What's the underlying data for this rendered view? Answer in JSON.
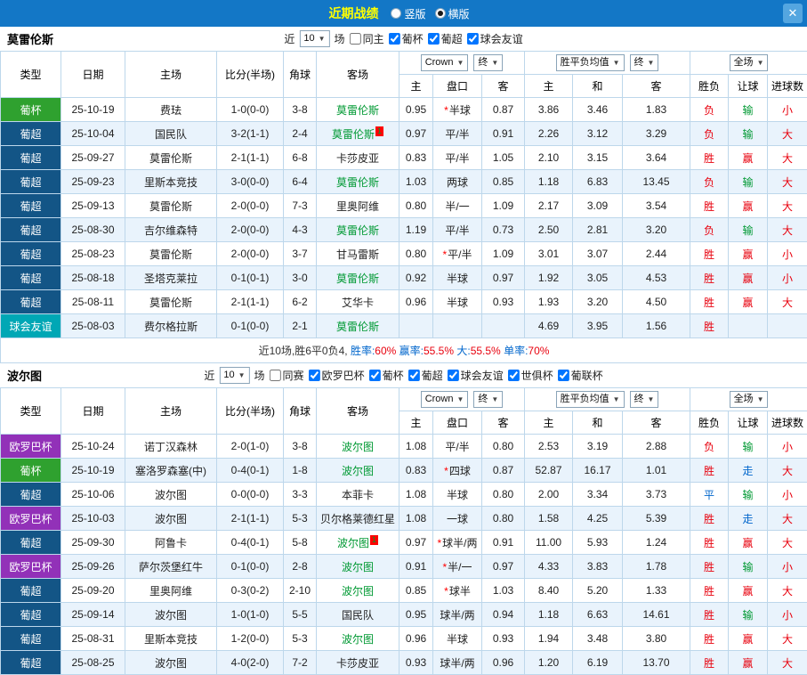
{
  "topbar": {
    "title": "近期战绩",
    "vertical_label": "竖版",
    "horizontal_label": "横版",
    "selected_layout": "横版",
    "close_glyph": "✕"
  },
  "type_colors": {
    "葡杯": "#2fa12f",
    "葡超": "#135586",
    "球会友谊": "#00a7b5",
    "欧罗巴杯": "#9231b8"
  },
  "header_labels": {
    "type": "类型",
    "date": "日期",
    "home": "主场",
    "score": "比分(半场)",
    "corner": "角球",
    "away": "客场",
    "odds_provider": "Crown",
    "odds_final": "终",
    "avg_label": "胜平负均值",
    "avg_final": "终",
    "scope": "全场",
    "sub": [
      "主",
      "盘口",
      "客",
      "主",
      "和",
      "客",
      "胜负",
      "让球",
      "进球数"
    ]
  },
  "sections": [
    {
      "team": "莫雷伦斯",
      "filter": {
        "near": "近",
        "count": "10",
        "unit": "场",
        "checkboxes": [
          {
            "label": "同主",
            "checked": false
          },
          {
            "label": "葡杯",
            "checked": true
          },
          {
            "label": "葡超",
            "checked": true
          },
          {
            "label": "球会友谊",
            "checked": true
          }
        ]
      },
      "rows": [
        {
          "type": "葡杯",
          "date": "25-10-19",
          "home": "费珐",
          "home_hl": false,
          "score": "1-0(0-0)",
          "corner": "3-8",
          "away": "莫雷伦斯",
          "away_hl": true,
          "o1": "0.95",
          "star": true,
          "hcap": "半球",
          "o2": "0.87",
          "a1": "3.86",
          "a2": "3.46",
          "a3": "1.83",
          "r1": "负",
          "r1c": "red",
          "r2": "输",
          "r2c": "green",
          "r3": "小",
          "r3c": "red"
        },
        {
          "type": "葡超",
          "date": "25-10-04",
          "home": "国民队",
          "home_hl": false,
          "score": "3-2(1-1)",
          "corner": "2-4",
          "away": "莫雷伦斯",
          "away_hl": true,
          "away_badge": "1",
          "o1": "0.97",
          "star": false,
          "hcap": "平/半",
          "o2": "0.91",
          "a1": "2.26",
          "a2": "3.12",
          "a3": "3.29",
          "r1": "负",
          "r1c": "red",
          "r2": "输",
          "r2c": "green",
          "r3": "大",
          "r3c": "red"
        },
        {
          "type": "葡超",
          "date": "25-09-27",
          "home": "莫雷伦斯",
          "home_hl": true,
          "score": "2-1(1-1)",
          "corner": "6-8",
          "away": "卡莎皮亚",
          "away_hl": false,
          "o1": "0.83",
          "star": false,
          "hcap": "平/半",
          "o2": "1.05",
          "a1": "2.10",
          "a2": "3.15",
          "a3": "3.64",
          "r1": "胜",
          "r1c": "red",
          "r2": "赢",
          "r2c": "red",
          "r3": "大",
          "r3c": "red"
        },
        {
          "type": "葡超",
          "date": "25-09-23",
          "home": "里斯本竞技",
          "home_hl": false,
          "score": "3-0(0-0)",
          "corner": "6-4",
          "away": "莫雷伦斯",
          "away_hl": true,
          "o1": "1.03",
          "star": false,
          "hcap": "两球",
          "o2": "0.85",
          "a1": "1.18",
          "a2": "6.83",
          "a3": "13.45",
          "r1": "负",
          "r1c": "red",
          "r2": "输",
          "r2c": "green",
          "r3": "大",
          "r3c": "red"
        },
        {
          "type": "葡超",
          "date": "25-09-13",
          "home": "莫雷伦斯",
          "home_hl": true,
          "score": "2-0(0-0)",
          "corner": "7-3",
          "away": "里奥阿维",
          "away_hl": false,
          "o1": "0.80",
          "star": false,
          "hcap": "半/一",
          "o2": "1.09",
          "a1": "2.17",
          "a2": "3.09",
          "a3": "3.54",
          "r1": "胜",
          "r1c": "red",
          "r2": "赢",
          "r2c": "red",
          "r3": "大",
          "r3c": "red"
        },
        {
          "type": "葡超",
          "date": "25-08-30",
          "home": "吉尔维森特",
          "home_hl": false,
          "score": "2-0(0-0)",
          "corner": "4-3",
          "away": "莫雷伦斯",
          "away_hl": true,
          "o1": "1.19",
          "star": false,
          "hcap": "平/半",
          "o2": "0.73",
          "a1": "2.50",
          "a2": "2.81",
          "a3": "3.20",
          "r1": "负",
          "r1c": "red",
          "r2": "输",
          "r2c": "green",
          "r3": "大",
          "r3c": "red"
        },
        {
          "type": "葡超",
          "date": "25-08-23",
          "home": "莫雷伦斯",
          "home_hl": true,
          "score": "2-0(0-0)",
          "corner": "3-7",
          "away": "甘马雷斯",
          "away_hl": false,
          "o1": "0.80",
          "star": true,
          "hcap": "平/半",
          "o2": "1.09",
          "a1": "3.01",
          "a2": "3.07",
          "a3": "2.44",
          "r1": "胜",
          "r1c": "red",
          "r2": "赢",
          "r2c": "red",
          "r3": "小",
          "r3c": "red"
        },
        {
          "type": "葡超",
          "date": "25-08-18",
          "home": "圣塔克莱拉",
          "home_hl": false,
          "score": "0-1(0-1)",
          "corner": "3-0",
          "away": "莫雷伦斯",
          "away_hl": true,
          "o1": "0.92",
          "star": false,
          "hcap": "半球",
          "o2": "0.97",
          "a1": "1.92",
          "a2": "3.05",
          "a3": "4.53",
          "r1": "胜",
          "r1c": "red",
          "r2": "赢",
          "r2c": "red",
          "r3": "小",
          "r3c": "red"
        },
        {
          "type": "葡超",
          "date": "25-08-11",
          "home": "莫雷伦斯",
          "home_hl": true,
          "score": "2-1(1-1)",
          "corner": "6-2",
          "away": "艾华卡",
          "away_hl": false,
          "o1": "0.96",
          "star": false,
          "hcap": "半球",
          "o2": "0.93",
          "a1": "1.93",
          "a2": "3.20",
          "a3": "4.50",
          "r1": "胜",
          "r1c": "red",
          "r2": "赢",
          "r2c": "red",
          "r3": "大",
          "r3c": "red"
        },
        {
          "type": "球会友谊",
          "date": "25-08-03",
          "home": "费尔格拉斯",
          "home_hl": false,
          "score": "0-1(0-0)",
          "corner": "2-1",
          "away": "莫雷伦斯",
          "away_hl": true,
          "o1": "",
          "star": false,
          "hcap": "",
          "o2": "",
          "a1": "4.69",
          "a2": "3.95",
          "a3": "1.56",
          "r1": "胜",
          "r1c": "red",
          "r2": "",
          "r2c": "",
          "r3": "",
          "r3c": ""
        }
      ],
      "summary": [
        {
          "text": "近10场,胜6平0负4,",
          "color": "#333333"
        },
        {
          "text": " 胜率:",
          "color": "#0066cc"
        },
        {
          "text": "60%",
          "color": "#e8000d"
        },
        {
          "text": " 赢率:",
          "color": "#0066cc"
        },
        {
          "text": "55.5%",
          "color": "#e8000d"
        },
        {
          "text": " 大:",
          "color": "#0066cc"
        },
        {
          "text": "55.5%",
          "color": "#e8000d"
        },
        {
          "text": " 单率:",
          "color": "#0066cc"
        },
        {
          "text": "70%",
          "color": "#e8000d"
        }
      ]
    },
    {
      "team": "波尔图",
      "filter": {
        "near": "近",
        "count": "10",
        "unit": "场",
        "checkboxes": [
          {
            "label": "同赛",
            "checked": false
          },
          {
            "label": "欧罗巴杯",
            "checked": true
          },
          {
            "label": "葡杯",
            "checked": true
          },
          {
            "label": "葡超",
            "checked": true
          },
          {
            "label": "球会友谊",
            "checked": true
          },
          {
            "label": "世俱杯",
            "checked": true
          },
          {
            "label": "葡联杯",
            "checked": true
          }
        ]
      },
      "rows": [
        {
          "type": "欧罗巴杯",
          "date": "25-10-24",
          "home": "诺丁汉森林",
          "home_hl": false,
          "score": "2-0(1-0)",
          "corner": "3-8",
          "away": "波尔图",
          "away_hl": true,
          "o1": "1.08",
          "star": false,
          "hcap": "平/半",
          "o2": "0.80",
          "a1": "2.53",
          "a2": "3.19",
          "a3": "2.88",
          "r1": "负",
          "r1c": "red",
          "r2": "输",
          "r2c": "green",
          "r3": "小",
          "r3c": "red"
        },
        {
          "type": "葡杯",
          "date": "25-10-19",
          "home": "塞洛罗森塞(中)",
          "home_hl": false,
          "score": "0-4(0-1)",
          "corner": "1-8",
          "away": "波尔图",
          "away_hl": true,
          "o1": "0.83",
          "star": true,
          "hcap": "四球",
          "o2": "0.87",
          "a1": "52.87",
          "a2": "16.17",
          "a3": "1.01",
          "r1": "胜",
          "r1c": "red",
          "r2": "走",
          "r2c": "blue",
          "r3": "大",
          "r3c": "red"
        },
        {
          "type": "葡超",
          "date": "25-10-06",
          "home": "波尔图",
          "home_hl": true,
          "score": "0-0(0-0)",
          "corner": "3-3",
          "away": "本菲卡",
          "away_hl": false,
          "o1": "1.08",
          "star": false,
          "hcap": "半球",
          "o2": "0.80",
          "a1": "2.00",
          "a2": "3.34",
          "a3": "3.73",
          "r1": "平",
          "r1c": "blue",
          "r2": "输",
          "r2c": "green",
          "r3": "小",
          "r3c": "red"
        },
        {
          "type": "欧罗巴杯",
          "date": "25-10-03",
          "home": "波尔图",
          "home_hl": true,
          "score": "2-1(1-1)",
          "corner": "5-3",
          "away": "贝尔格莱德红星",
          "away_hl": false,
          "o1": "1.08",
          "star": false,
          "hcap": "一球",
          "o2": "0.80",
          "a1": "1.58",
          "a2": "4.25",
          "a3": "5.39",
          "r1": "胜",
          "r1c": "red",
          "r2": "走",
          "r2c": "blue",
          "r3": "大",
          "r3c": "red"
        },
        {
          "type": "葡超",
          "date": "25-09-30",
          "home": "阿鲁卡",
          "home_hl": false,
          "score": "0-4(0-1)",
          "corner": "5-8",
          "away": "波尔图",
          "away_hl": true,
          "away_badge": "1",
          "o1": "0.97",
          "star": true,
          "hcap": "球半/两",
          "o2": "0.91",
          "a1": "11.00",
          "a2": "5.93",
          "a3": "1.24",
          "r1": "胜",
          "r1c": "red",
          "r2": "赢",
          "r2c": "red",
          "r3": "大",
          "r3c": "red"
        },
        {
          "type": "欧罗巴杯",
          "date": "25-09-26",
          "home": "萨尔茨堡红牛",
          "home_hl": false,
          "score": "0-1(0-0)",
          "corner": "2-8",
          "away": "波尔图",
          "away_hl": true,
          "o1": "0.91",
          "star": true,
          "hcap": "半/一",
          "o2": "0.97",
          "a1": "4.33",
          "a2": "3.83",
          "a3": "1.78",
          "r1": "胜",
          "r1c": "red",
          "r2": "输",
          "r2c": "green",
          "r3": "小",
          "r3c": "red"
        },
        {
          "type": "葡超",
          "date": "25-09-20",
          "home": "里奥阿维",
          "home_hl": false,
          "score": "0-3(0-2)",
          "corner": "2-10",
          "away": "波尔图",
          "away_hl": true,
          "o1": "0.85",
          "star": true,
          "hcap": "球半",
          "o2": "1.03",
          "a1": "8.40",
          "a2": "5.20",
          "a3": "1.33",
          "r1": "胜",
          "r1c": "red",
          "r2": "赢",
          "r2c": "red",
          "r3": "大",
          "r3c": "red"
        },
        {
          "type": "葡超",
          "date": "25-09-14",
          "home": "波尔图",
          "home_hl": true,
          "score": "1-0(1-0)",
          "corner": "5-5",
          "away": "国民队",
          "away_hl": false,
          "o1": "0.95",
          "star": false,
          "hcap": "球半/两",
          "o2": "0.94",
          "a1": "1.18",
          "a2": "6.63",
          "a3": "14.61",
          "r1": "胜",
          "r1c": "red",
          "r2": "输",
          "r2c": "green",
          "r3": "小",
          "r3c": "red"
        },
        {
          "type": "葡超",
          "date": "25-08-31",
          "home": "里斯本竞技",
          "home_hl": false,
          "score": "1-2(0-0)",
          "corner": "5-3",
          "away": "波尔图",
          "away_hl": true,
          "o1": "0.96",
          "star": false,
          "hcap": "半球",
          "o2": "0.93",
          "a1": "1.94",
          "a2": "3.48",
          "a3": "3.80",
          "r1": "胜",
          "r1c": "red",
          "r2": "赢",
          "r2c": "red",
          "r3": "大",
          "r3c": "red"
        },
        {
          "type": "葡超",
          "date": "25-08-25",
          "home": "波尔图",
          "home_hl": true,
          "score": "4-0(2-0)",
          "corner": "7-2",
          "away": "卡莎皮亚",
          "away_hl": false,
          "o1": "0.93",
          "star": false,
          "hcap": "球半/两",
          "o2": "0.96",
          "a1": "1.20",
          "a2": "6.19",
          "a3": "13.70",
          "r1": "胜",
          "r1c": "red",
          "r2": "赢",
          "r2c": "red",
          "r3": "大",
          "r3c": "red"
        }
      ]
    }
  ]
}
